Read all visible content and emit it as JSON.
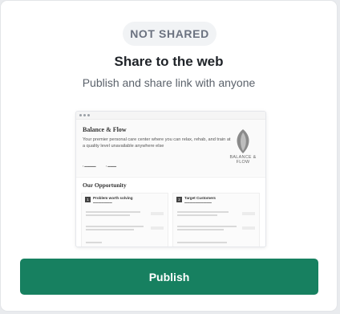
{
  "status_badge": "NOT SHARED",
  "title": "Share to the web",
  "subtitle": "Publish and share link with anyone",
  "publish_label": "Publish",
  "preview": {
    "brand": "Balance & Flow",
    "tagline": "Your premier personal care center where you can relax, rehab, and train at a quality level unavailable anywhere else",
    "logo_text": "BALANCE & FLOW",
    "section_title": "Our Opportunity",
    "col1_title": "Problem worth solving",
    "col1_number": "1",
    "col2_title": "Target Customers",
    "col2_number": "2"
  },
  "colors": {
    "accent": "#178060",
    "badge_bg": "#f1f3f5",
    "badge_text": "#6b7280"
  }
}
